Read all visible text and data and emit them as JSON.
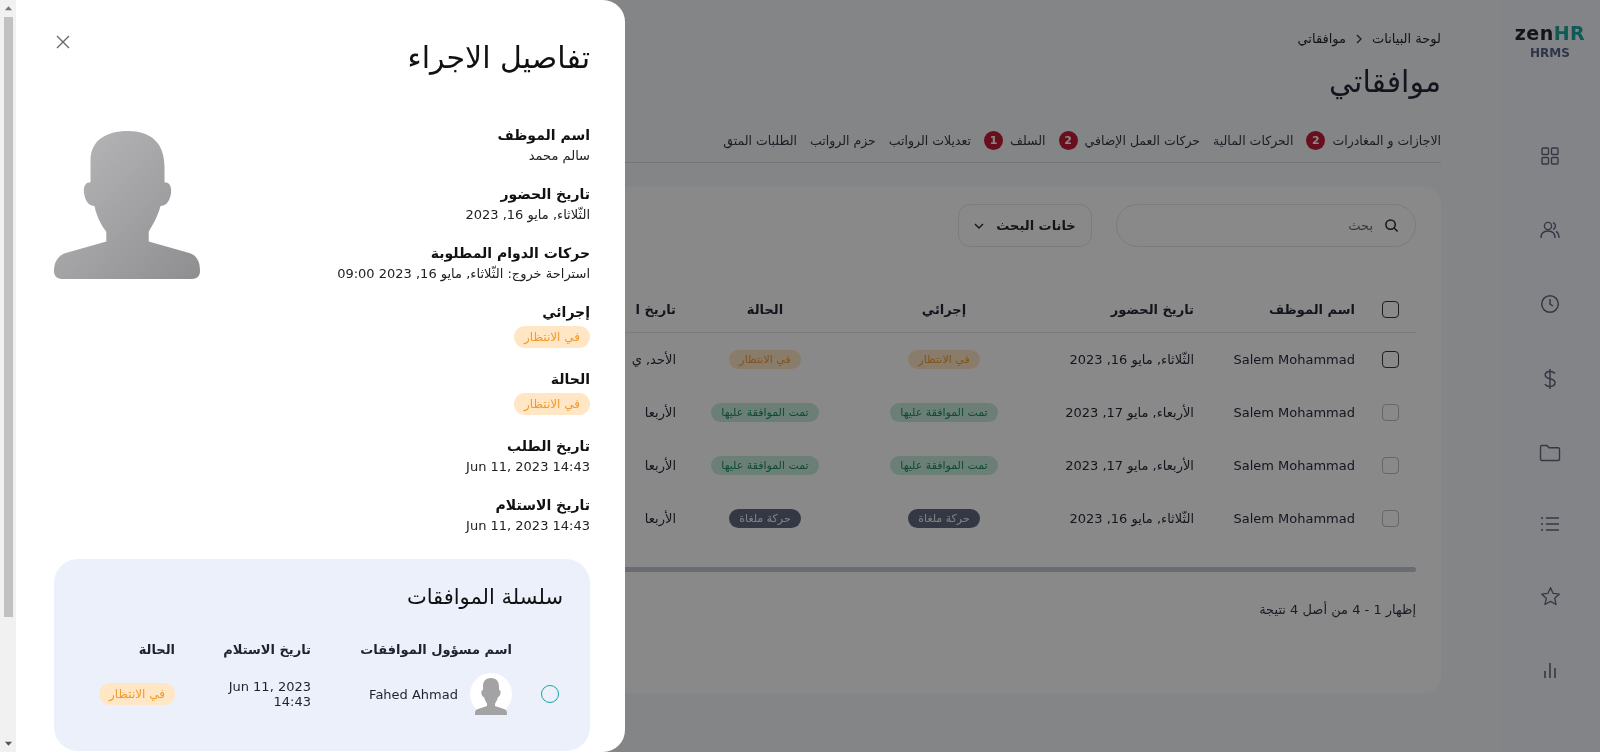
{
  "sidebar": {
    "logo": {
      "text": "zen",
      "accent": "HR",
      "subtitle": "HRMS"
    }
  },
  "breadcrumb": [
    {
      "label": "لوحة البيانات"
    },
    {
      "label": "موافقاتي"
    }
  ],
  "page_title": "موافقاتي",
  "tabs": [
    {
      "label": "الاجازات و المغادرات",
      "badge": "2"
    },
    {
      "label": "الحركات المالية"
    },
    {
      "label": "حركات العمل الإضافي",
      "badge": "2"
    },
    {
      "label": "السلف",
      "badge": "1"
    },
    {
      "label": "تعديلات الرواتب"
    },
    {
      "label": "حزم الرواتب"
    },
    {
      "label": "الطلبات المتق"
    }
  ],
  "search": {
    "placeholder": "بحث"
  },
  "search_fields_button": {
    "label": "خانات البحث"
  },
  "table": {
    "select_all_checked": false,
    "columns": [
      "اسم الموظف",
      "تاريخ الحضور",
      "إجرائي",
      "الحالة",
      "تاريخ ا"
    ],
    "rows": [
      {
        "checked": false,
        "disabled": false,
        "employee": "Salem Mohammad",
        "date": "الثّلاثاء, مايو 16, 2023",
        "action": {
          "label": "في الانتظار",
          "kind": "pending"
        },
        "status": {
          "label": "في الانتظار",
          "kind": "pending"
        },
        "column_5": "الأحد, ي"
      },
      {
        "checked": false,
        "disabled": true,
        "employee": "Salem Mohammad",
        "date": "الأربعاء, مايو 17, 2023",
        "action": {
          "label": "تمت الموافقة عليها",
          "kind": "approved"
        },
        "status": {
          "label": "تمت الموافقة عليها",
          "kind": "approved"
        },
        "column_5": "الأربعا"
      },
      {
        "checked": false,
        "disabled": true,
        "employee": "Salem Mohammad",
        "date": "الأربعاء, مايو 17, 2023",
        "action": {
          "label": "تمت الموافقة عليها",
          "kind": "approved"
        },
        "status": {
          "label": "تمت الموافقة عليها",
          "kind": "approved"
        },
        "column_5": "الأربعا"
      },
      {
        "checked": false,
        "disabled": true,
        "employee": "Salem Mohammad",
        "date": "الثّلاثاء, مايو 16, 2023",
        "action": {
          "label": "حركة ملغاة",
          "kind": "cancelled"
        },
        "status": {
          "label": "حركة ملغاة",
          "kind": "cancelled"
        },
        "column_5": "الأربعا"
      }
    ]
  },
  "footer": "إظهار 1 - 4 من أصل 4 نتيجة",
  "drawer": {
    "title": "تفاصيل الاجراء",
    "fields": [
      {
        "kind": "text",
        "label": "اسم الموظف",
        "value": "سالم محمد"
      },
      {
        "kind": "text",
        "label": "تاريخ الحضور",
        "value": "الثّلاثاء, مايو 16, 2023"
      },
      {
        "kind": "text",
        "label": "حركات الدوام المطلوبة",
        "value": "استراحة خروج: الثّلاثاء, مايو 16, 2023 09:00"
      },
      {
        "kind": "badge",
        "label": "إجرائي",
        "badge": {
          "label": "في الانتظار",
          "kind": "pending"
        }
      },
      {
        "kind": "badge",
        "label": "الحالة",
        "badge": {
          "label": "في الانتظار",
          "kind": "pending"
        }
      },
      {
        "kind": "text",
        "label": "تاريخ الطلب",
        "value": "Jun 11, 2023 14:43"
      },
      {
        "kind": "text",
        "label": "تاريخ الاستلام",
        "value": "Jun 11, 2023 14:43"
      }
    ],
    "approval_chain": {
      "title": "سلسلة الموافقات",
      "columns": [
        "اسم مسؤول الموافقات",
        "تاريخ الاستلام",
        "الحالة"
      ],
      "rows": [
        {
          "selected": false,
          "name": "Fahed Ahmad",
          "date": "Jun 11, 2023 14:43",
          "status": {
            "label": "في الانتظار",
            "kind": "pending"
          }
        }
      ]
    }
  }
}
